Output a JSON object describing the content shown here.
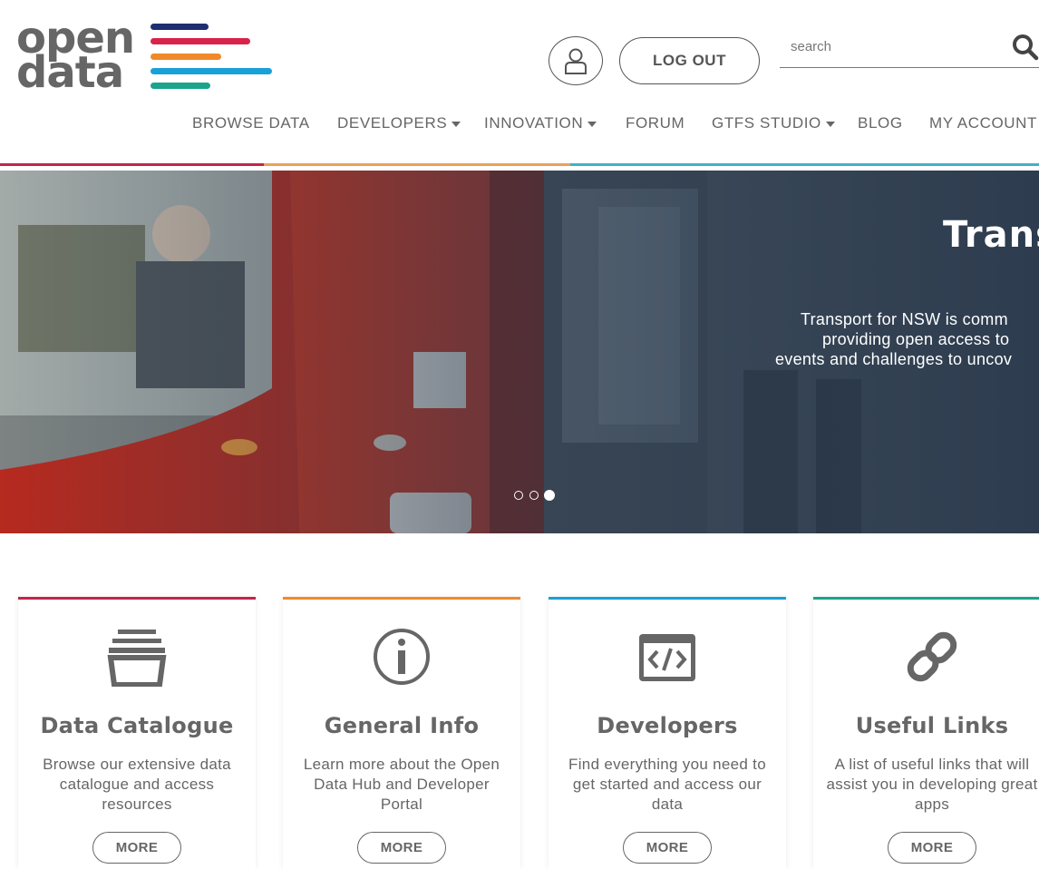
{
  "header": {
    "logo": {
      "line1": "open",
      "line2": "data"
    },
    "logout_label": "LOG OUT",
    "search_placeholder": "search"
  },
  "nav": {
    "items": [
      {
        "label": "BROWSE DATA",
        "dropdown": false
      },
      {
        "label": "DEVELOPERS",
        "dropdown": true
      },
      {
        "label": "INNOVATION",
        "dropdown": true
      },
      {
        "label": "FORUM",
        "dropdown": false
      },
      {
        "label": "GTFS STUDIO",
        "dropdown": true
      },
      {
        "label": "BLOG",
        "dropdown": false
      },
      {
        "label": "MY ACCOUNT",
        "dropdown": false
      }
    ]
  },
  "hero": {
    "title": "Trans",
    "lines": [
      "Transport for NSW is comm",
      "providing open access to",
      "events and challenges to uncov"
    ],
    "slides": 3,
    "active_slide": 3
  },
  "cards": [
    {
      "title": "Data Catalogue",
      "description": "Browse our extensive data catalogue and access resources",
      "button": "MORE",
      "icon": "stack-icon"
    },
    {
      "title": "General Info",
      "description": "Learn more about the Open Data Hub and Developer Portal",
      "button": "MORE",
      "icon": "info-icon"
    },
    {
      "title": "Developers",
      "description": "Find everything you need to get started and access our data",
      "button": "MORE",
      "icon": "code-icon"
    },
    {
      "title": "Useful Links",
      "description": "A list of useful links that will assist you in developing great apps",
      "button": "MORE",
      "icon": "link-icon"
    }
  ],
  "colors": {
    "brand_red": "#d8234a",
    "brand_orange": "#f0892b",
    "brand_blue": "#18a0d9",
    "brand_teal": "#19a48b",
    "brand_navy": "#1d2f6e",
    "text_grey": "#666666"
  }
}
